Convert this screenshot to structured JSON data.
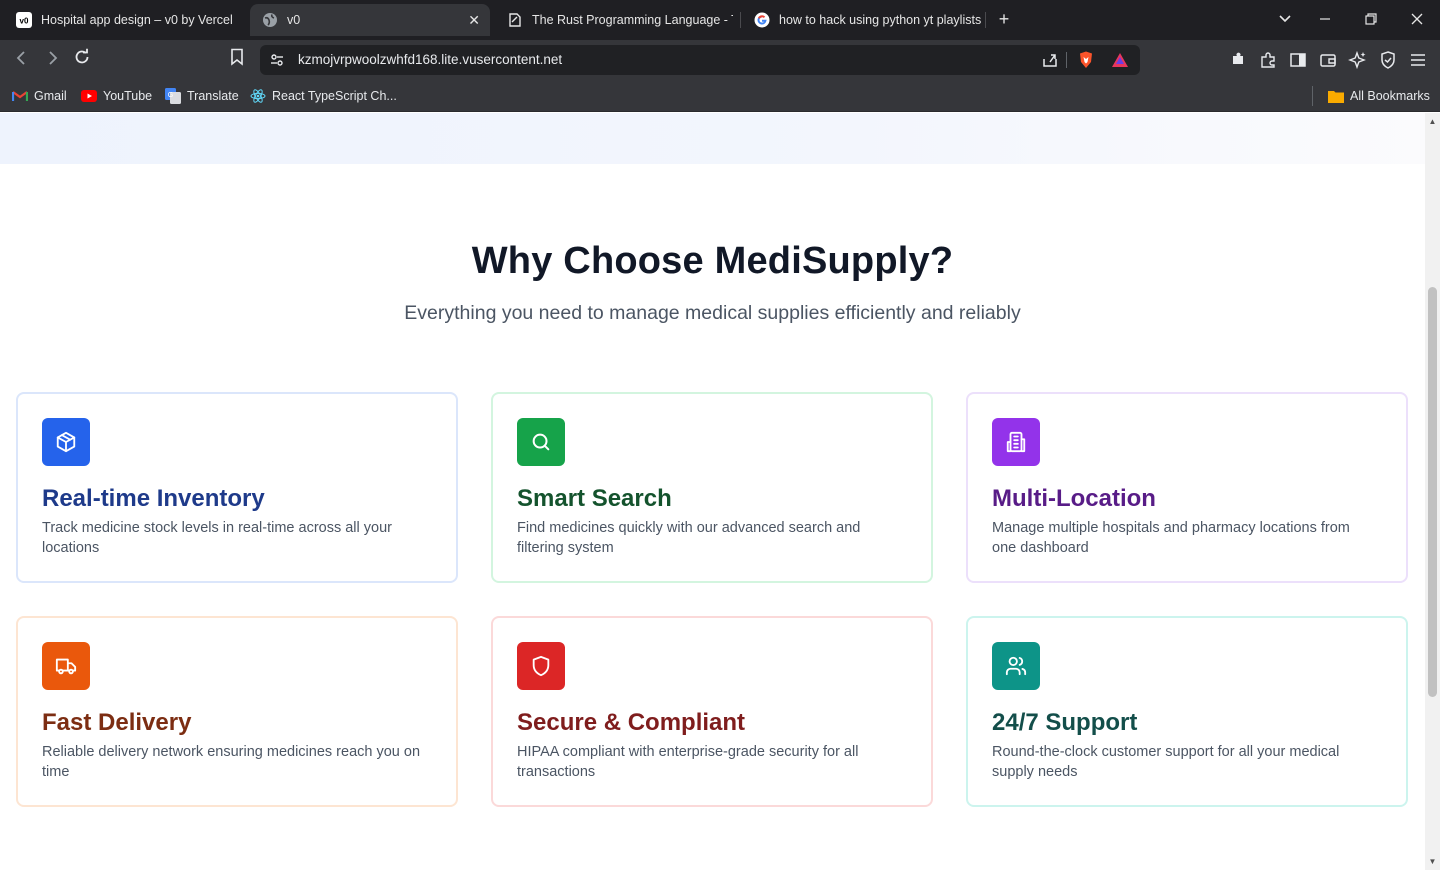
{
  "browser": {
    "tabs": [
      {
        "title": "Hospital app design – v0 by Vercel",
        "active": false
      },
      {
        "title": "v0",
        "active": true
      },
      {
        "title": "The Rust Programming Language - T",
        "active": false
      },
      {
        "title": "how to hack using python yt playlists",
        "active": false
      }
    ],
    "url": "kzmojvrpwoolzwhfd168.lite.vusercontent.net",
    "bookmarks": [
      {
        "label": "Gmail"
      },
      {
        "label": "YouTube"
      },
      {
        "label": "Translate"
      },
      {
        "label": "React TypeScript Ch..."
      }
    ],
    "all_bookmarks": "All Bookmarks"
  },
  "features": {
    "title": "Why Choose MediSupply?",
    "subtitle": "Everything you need to manage medical supplies efficiently and reliably",
    "cards": [
      {
        "title": "Real-time Inventory",
        "description": "Track medicine stock levels in real-time across all your locations",
        "icon": "box-icon",
        "accent": "#2563eb",
        "title_color": "#1e3a8a",
        "border": "#dbe6fb"
      },
      {
        "title": "Smart Search",
        "description": "Find medicines quickly with our advanced search and filtering system",
        "icon": "search-icon",
        "accent": "#16a34a",
        "title_color": "#14532d",
        "border": "#d3f5df"
      },
      {
        "title": "Multi-Location",
        "description": "Manage multiple hospitals and pharmacy locations from one dashboard",
        "icon": "building-icon",
        "accent": "#9333ea",
        "title_color": "#581c87",
        "border": "#ece0fb"
      },
      {
        "title": "Fast Delivery",
        "description": "Reliable delivery network ensuring medicines reach you on time",
        "icon": "truck-icon",
        "accent": "#ea580c",
        "title_color": "#7c2d12",
        "border": "#fde5d2"
      },
      {
        "title": "Secure & Compliant",
        "description": "HIPAA compliant with enterprise-grade security for all transactions",
        "icon": "shield-icon",
        "accent": "#dc2626",
        "title_color": "#7f1d1d",
        "border": "#fbd9d9"
      },
      {
        "title": "24/7 Support",
        "description": "Round-the-clock customer support for all your medical supply needs",
        "icon": "users-icon",
        "accent": "#0d9488",
        "title_color": "#134e4a",
        "border": "#ccf4ee"
      }
    ]
  }
}
